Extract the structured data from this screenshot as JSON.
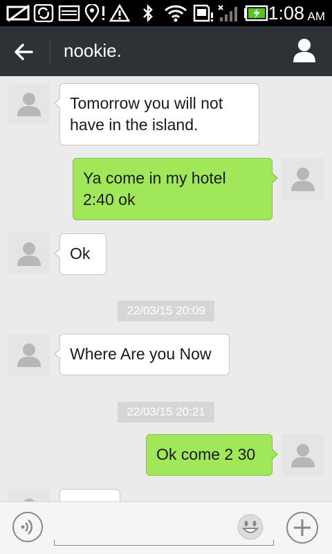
{
  "status_bar": {
    "time": "1:08",
    "ampm": "AM",
    "icons": [
      "no-sim-icon",
      "sync-icon",
      "image-icon",
      "location-icon",
      "warning-icon",
      "bluetooth-icon",
      "wifi-icon",
      "sd-card-icon",
      "signal-icon",
      "battery-charging-icon"
    ]
  },
  "header": {
    "title": "nookie.",
    "back_icon": "back-arrow-icon",
    "profile_icon": "profile-icon"
  },
  "messages": [
    {
      "direction": "in",
      "lines": [
        "Tomorrow you will not",
        "have in the island."
      ]
    },
    {
      "direction": "out",
      "lines": [
        "Ya come in my hotel",
        "2:40 ok"
      ]
    },
    {
      "direction": "in",
      "lines": [
        "Ok"
      ]
    },
    {
      "type": "timestamp",
      "text": "22/03/15 20:09"
    },
    {
      "direction": "in",
      "lines": [
        "Where Are you Now"
      ]
    },
    {
      "type": "timestamp",
      "text": "22/03/15 20:21"
    },
    {
      "direction": "out",
      "lines": [
        "Ok come 2 30"
      ]
    }
  ],
  "input_bar": {
    "voice_icon": "voice-icon",
    "emoji_icon": "emoji-icon",
    "plus_icon": "plus-icon"
  },
  "colors": {
    "status_bar_bg": "#000000",
    "action_bar_bg": "#2d3236",
    "chat_bg": "#ebebeb",
    "incoming_bubble": "#ffffff",
    "outgoing_bubble": "#a0e75a"
  }
}
